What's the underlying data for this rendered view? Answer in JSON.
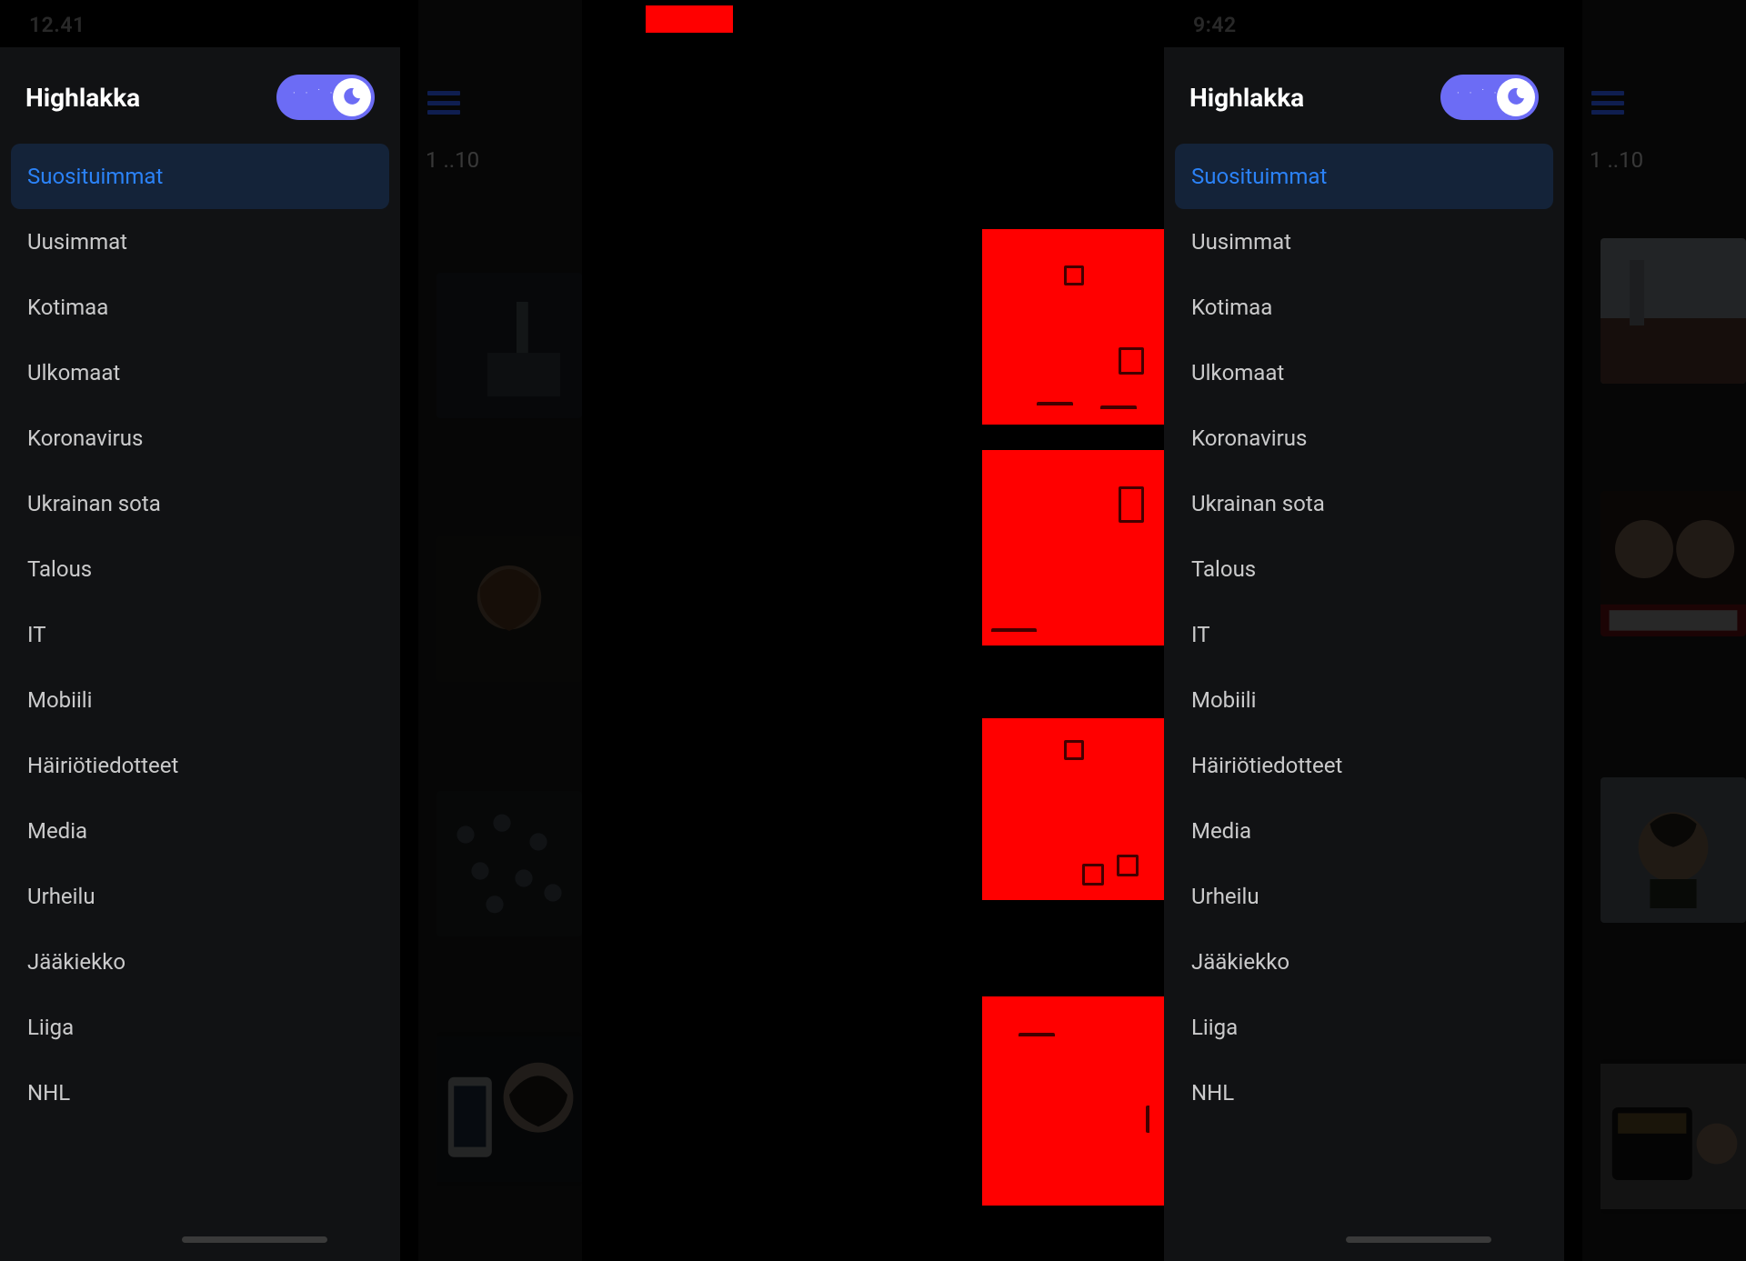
{
  "left": {
    "status_time": "12.41",
    "app_title": "Highlakka",
    "range": "1 ..10"
  },
  "right": {
    "status_time": "9:42",
    "app_title": "Highlakka",
    "range": "1 ..10"
  },
  "sidebar": {
    "items": [
      {
        "label": "Suosituimmat",
        "active": true
      },
      {
        "label": "Uusimmat"
      },
      {
        "label": "Kotimaa"
      },
      {
        "label": "Ulkomaat"
      },
      {
        "label": "Koronavirus"
      },
      {
        "label": "Ukrainan sota"
      },
      {
        "label": "Talous"
      },
      {
        "label": "IT"
      },
      {
        "label": "Mobiili"
      },
      {
        "label": "Häiriötiedotteet"
      },
      {
        "label": "Media"
      },
      {
        "label": "Urheilu"
      },
      {
        "label": "Jääkiekko"
      },
      {
        "label": "Liiga"
      },
      {
        "label": "NHL"
      }
    ]
  },
  "icons": {
    "moon": "moon-icon",
    "hamburger": "hamburger-icon",
    "wifi": "wifi-icon",
    "battery": "battery-icon"
  }
}
